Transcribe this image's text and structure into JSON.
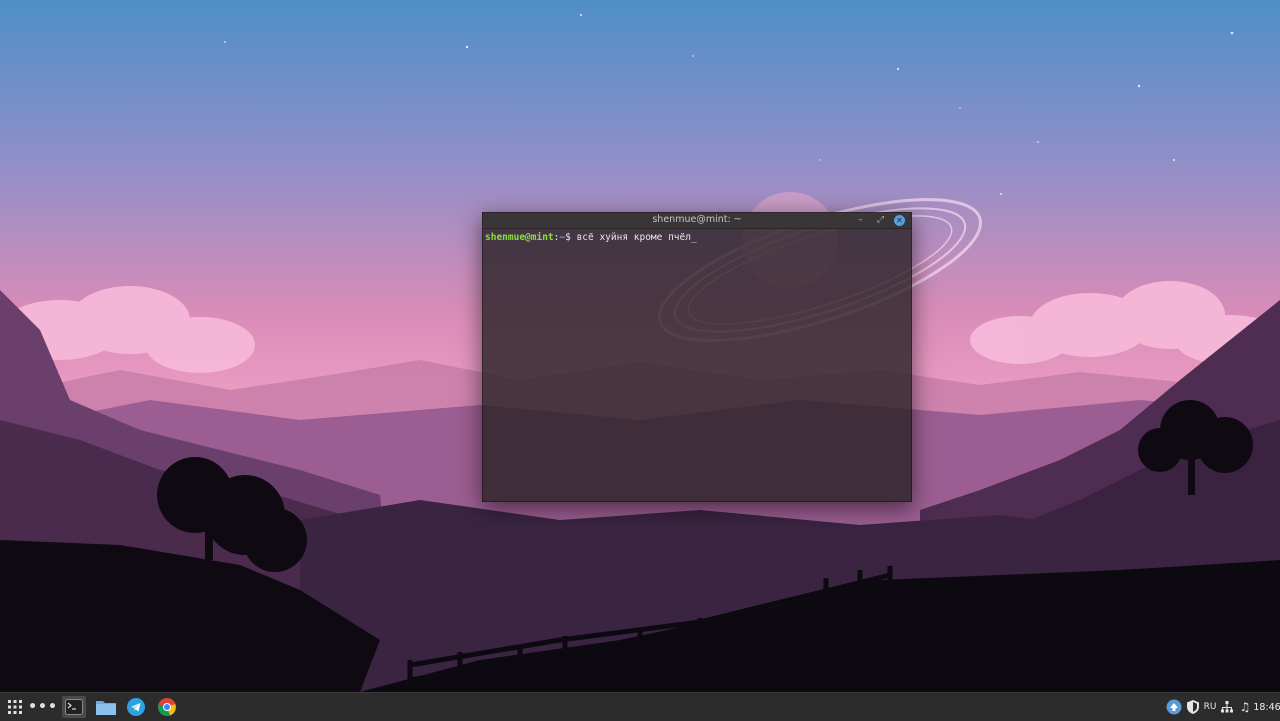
{
  "terminal": {
    "title": "shenmue@mint: ~",
    "prompt_user": "shenmue@mint",
    "prompt_sep": ":",
    "prompt_path": "~",
    "prompt_sign": "$ ",
    "command": "всё хуйня кроме пчёл",
    "cursor": "_",
    "min_glyph": "–",
    "max_glyph": "⤢",
    "close_glyph": "✕"
  },
  "taskbar": {
    "icons": [
      "apps-menu-icon",
      "show-desktop-icon",
      "terminal-icon",
      "files-icon",
      "telegram-icon",
      "chrome-icon"
    ],
    "dots": "•••",
    "tray": {
      "language": "RU",
      "clock": "18:46",
      "volume_glyph": "♫"
    }
  },
  "colors": {
    "prompt_user": "#8ae234",
    "prompt_path": "#729fcf",
    "close_button": "#5aa0d8",
    "taskbar": "#2c2c2c"
  }
}
